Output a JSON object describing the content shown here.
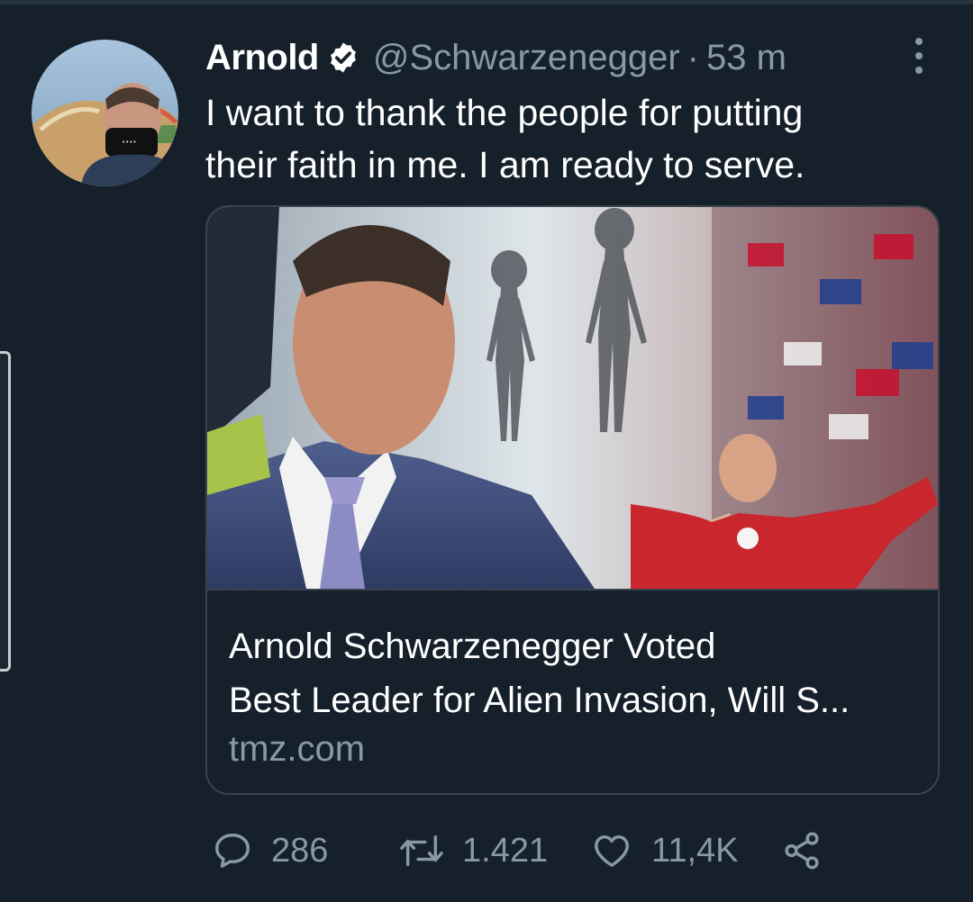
{
  "tweet": {
    "author": {
      "display_name": "Arnold",
      "handle": "@Schwarzenegger",
      "verified": true
    },
    "separator": "·",
    "time": "53 m",
    "text_line1": "I want to thank the people for putting",
    "text_line2": "their faith in me. I am ready to serve.",
    "card": {
      "title_line1": "Arnold Schwarzenegger Voted",
      "title_line2": "Best Leader for Alien Invasion, Will S...",
      "domain": "tmz.com"
    },
    "actions": {
      "replies": "286",
      "retweets": "1.421",
      "likes": "11,4K"
    }
  },
  "colors": {
    "background": "#15202b",
    "secondary_text": "#8899a6",
    "border": "#38444d",
    "verified_badge": "#ffffff"
  },
  "icons": [
    "more-vertical-icon",
    "verified-badge-icon",
    "reply-icon",
    "retweet-icon",
    "like-icon",
    "share-icon"
  ]
}
